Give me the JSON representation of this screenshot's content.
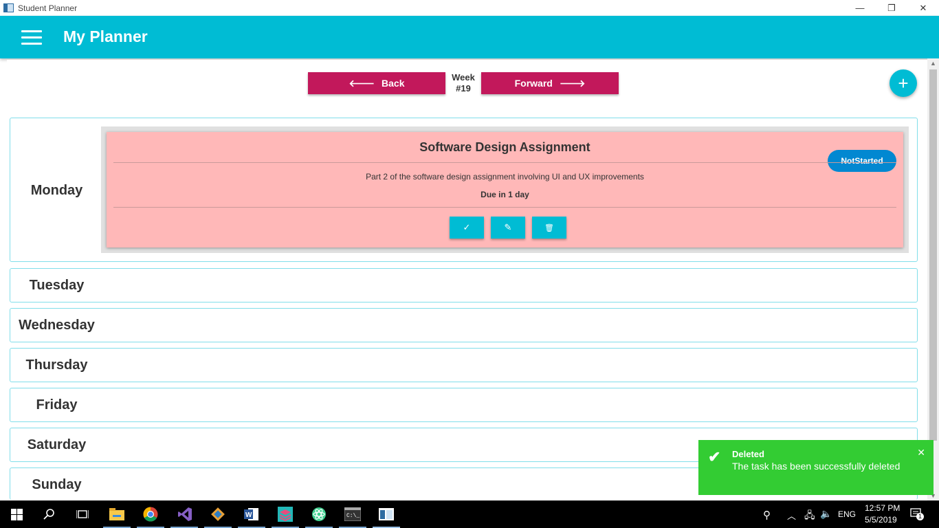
{
  "window": {
    "title": "Student Planner",
    "minimize": "—",
    "restore": "❐",
    "close": "✕"
  },
  "header": {
    "title": "My Planner"
  },
  "nav": {
    "back_label": "Back",
    "forward_label": "Forward",
    "week_label": "Week",
    "week_number": "#19",
    "add_icon": "+"
  },
  "days": {
    "monday": "Monday",
    "tuesday": "Tuesday",
    "wednesday": "Wednesday",
    "thursday": "Thursday",
    "friday": "Friday",
    "saturday": "Saturday",
    "sunday": "Sunday"
  },
  "task": {
    "title": "Software Design Assignment",
    "description": "Part 2 of the software design assignment involving UI and UX improvements",
    "due": "Due in 1 day",
    "status": "NotStarted",
    "complete_icon": "✓",
    "edit_icon": "✎",
    "delete_icon": "🗑"
  },
  "toast": {
    "title": "Deleted",
    "message": "The task has been successfully deleted",
    "check_icon": "✔",
    "close_icon": "✕"
  },
  "taskbar": {
    "lang": "ENG",
    "time": "12:57 PM",
    "date": "5/5/2019",
    "notification_count": "1"
  },
  "colors": {
    "primary": "#00bcd4",
    "accent": "#c2185b",
    "task_bg": "#ffb8b8",
    "status": "#0288d1",
    "toast": "#33cc33"
  }
}
